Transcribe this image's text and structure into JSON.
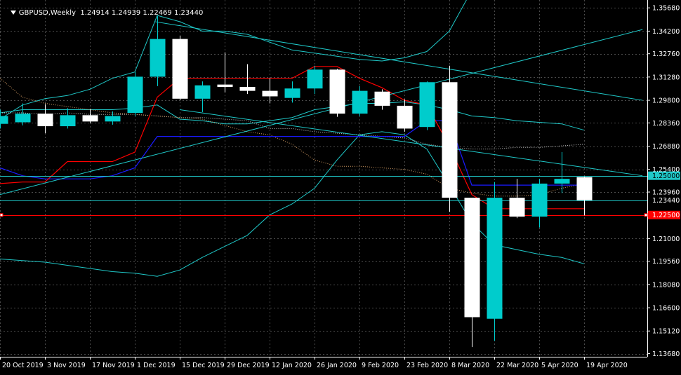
{
  "header": {
    "symbol": "GBPUSD,Weekly",
    "ohlc": "1.24914 1.24939 1.22469 1.23440"
  },
  "colors": {
    "background": "#000000",
    "grid": "#4a4a4a",
    "bull": "#00cccc",
    "bear": "#ffffff",
    "ma_red": "#ff0000",
    "ma_blue": "#1a1aff",
    "cyan_lines": "#1fc8c8",
    "hline_red": "#ff0000",
    "axis_text": "#ffffff"
  },
  "chart_data": {
    "type": "candlestick",
    "ylim": [
      1.1348,
      1.3618
    ],
    "y_ticks": [
      "1.35680",
      "1.34200",
      "1.32760",
      "1.31280",
      "1.29800",
      "1.28360",
      "1.26880",
      "1.25400",
      "1.23960",
      "1.22500",
      "1.21000",
      "1.19560",
      "1.18080",
      "1.16600",
      "1.15120",
      "1.13680"
    ],
    "x_labels": [
      {
        "i": 0,
        "label": "20 Oct 2019"
      },
      {
        "i": 2,
        "label": "3 Nov 2019"
      },
      {
        "i": 4,
        "label": "17 Nov 2019"
      },
      {
        "i": 6,
        "label": "1 Dec 2019"
      },
      {
        "i": 8,
        "label": "15 Dec 2019"
      },
      {
        "i": 10,
        "label": "29 Dec 2019"
      },
      {
        "i": 12,
        "label": "12 Jan 2020"
      },
      {
        "i": 14,
        "label": "26 Jan 2020"
      },
      {
        "i": 16,
        "label": "9 Feb 2020"
      },
      {
        "i": 18,
        "label": "23 Feb 2020"
      },
      {
        "i": 20,
        "label": "8 Mar 2020"
      },
      {
        "i": 22,
        "label": "22 Mar 2020"
      },
      {
        "i": 24,
        "label": "5 Apr 2020"
      },
      {
        "i": 26,
        "label": "19 Apr 2020"
      }
    ],
    "candles": [
      {
        "o": 1.283,
        "h": 1.292,
        "l": 1.28,
        "c": 1.288
      },
      {
        "o": 1.284,
        "h": 1.296,
        "l": 1.282,
        "c": 1.2895
      },
      {
        "o": 1.2895,
        "h": 1.2955,
        "l": 1.277,
        "c": 1.2815
      },
      {
        "o": 1.2815,
        "h": 1.293,
        "l": 1.28,
        "c": 1.2885
      },
      {
        "o": 1.2885,
        "h": 1.2925,
        "l": 1.2835,
        "c": 1.2845
      },
      {
        "o": 1.2845,
        "h": 1.291,
        "l": 1.2825,
        "c": 1.288
      },
      {
        "o": 1.29,
        "h": 1.316,
        "l": 1.288,
        "c": 1.313
      },
      {
        "o": 1.313,
        "h": 1.3515,
        "l": 1.307,
        "c": 1.337
      },
      {
        "o": 1.337,
        "h": 1.339,
        "l": 1.298,
        "c": 1.299
      },
      {
        "o": 1.299,
        "h": 1.31,
        "l": 1.2905,
        "c": 1.3075
      },
      {
        "o": 1.308,
        "h": 1.3285,
        "l": 1.303,
        "c": 1.3065
      },
      {
        "o": 1.3065,
        "h": 1.321,
        "l": 1.302,
        "c": 1.304
      },
      {
        "o": 1.304,
        "h": 1.312,
        "l": 1.296,
        "c": 1.3005
      },
      {
        "o": 1.2995,
        "h": 1.31,
        "l": 1.2965,
        "c": 1.3055
      },
      {
        "o": 1.3055,
        "h": 1.32,
        "l": 1.302,
        "c": 1.3175
      },
      {
        "o": 1.3175,
        "h": 1.318,
        "l": 1.2875,
        "c": 1.2895
      },
      {
        "o": 1.2895,
        "h": 1.307,
        "l": 1.288,
        "c": 1.304
      },
      {
        "o": 1.3035,
        "h": 1.305,
        "l": 1.292,
        "c": 1.2945
      },
      {
        "o": 1.2945,
        "h": 1.2985,
        "l": 1.278,
        "c": 1.28
      },
      {
        "o": 1.281,
        "h": 1.31,
        "l": 1.279,
        "c": 1.3095
      },
      {
        "o": 1.3095,
        "h": 1.32,
        "l": 1.227,
        "c": 1.236
      },
      {
        "o": 1.236,
        "h": 1.236,
        "l": 1.141,
        "c": 1.16
      },
      {
        "o": 1.159,
        "h": 1.246,
        "l": 1.145,
        "c": 1.236
      },
      {
        "o": 1.236,
        "h": 1.248,
        "l": 1.223,
        "c": 1.224
      },
      {
        "o": 1.224,
        "h": 1.248,
        "l": 1.217,
        "c": 1.245
      },
      {
        "o": 1.245,
        "h": 1.265,
        "l": 1.239,
        "c": 1.248
      },
      {
        "o": 1.2491,
        "h": 1.2494,
        "l": 1.2247,
        "c": 1.2344
      }
    ],
    "ma_red": [
      1.245,
      1.246,
      1.246,
      1.259,
      1.259,
      1.259,
      1.265,
      1.3,
      1.312,
      1.312,
      1.312,
      1.312,
      1.312,
      1.312,
      1.3195,
      1.3195,
      1.312,
      1.306,
      1.298,
      1.295,
      1.269,
      1.238,
      1.229,
      1.229,
      1.229,
      1.229,
      1.229
    ],
    "ma_blue": [
      1.255,
      1.25,
      1.248,
      1.248,
      1.248,
      1.25,
      1.255,
      1.275,
      1.275,
      1.275,
      1.275,
      1.275,
      1.275,
      1.275,
      1.275,
      1.275,
      1.275,
      1.275,
      1.275,
      1.285,
      1.285,
      1.244,
      1.244,
      1.244,
      1.244,
      1.244,
      1.244
    ],
    "orange_dotted": [
      1.312,
      1.3,
      1.296,
      1.294,
      1.292,
      1.29,
      1.289,
      1.288,
      1.287,
      1.286,
      1.282,
      1.278,
      1.276,
      1.27,
      1.26,
      1.256,
      1.256,
      1.255,
      1.254,
      1.251,
      1.242,
      1.239,
      1.237,
      1.237,
      1.238,
      1.242,
      1.245
    ],
    "white_dotted": [
      1.29,
      1.29,
      1.289,
      1.29,
      1.289,
      1.289,
      1.289,
      1.288,
      1.287,
      1.287,
      1.286,
      1.285,
      1.28,
      1.28,
      1.278,
      1.277,
      1.276,
      1.275,
      1.274,
      1.27,
      1.268,
      1.267,
      1.267,
      1.268,
      1.268,
      1.269,
      1.27
    ],
    "bb_upper": [
      1.286,
      1.295,
      1.299,
      1.301,
      1.305,
      1.312,
      1.316,
      1.352,
      1.348,
      1.342,
      1.342,
      1.34,
      1.335,
      1.33,
      1.328,
      1.326,
      1.324,
      1.323,
      1.325,
      1.329,
      1.342,
      1.368,
      1.37,
      1.37,
      1.37,
      1.365,
      1.362
    ],
    "bb_middle": [
      1.29,
      1.292,
      1.292,
      1.292,
      1.292,
      1.292,
      1.293,
      1.295,
      1.286,
      1.285,
      1.283,
      1.283,
      1.285,
      1.287,
      1.292,
      1.294,
      1.296,
      1.296,
      1.297,
      1.295,
      1.292,
      1.288,
      1.287,
      1.285,
      1.284,
      1.283,
      1.279
    ],
    "bb_lower": [
      1.197,
      1.196,
      1.195,
      1.193,
      1.191,
      1.189,
      1.188,
      1.186,
      1.19,
      1.198,
      1.205,
      1.212,
      1.225,
      1.232,
      1.242,
      1.26,
      1.276,
      1.278,
      1.276,
      1.267,
      1.244,
      1.22,
      1.206,
      1.203,
      1.2,
      1.198,
      1.194
    ],
    "trend_lines": [
      {
        "x1": 0,
        "y1": 1.238,
        "x2": 28.6,
        "y2": 1.343
      },
      {
        "x1": 6.9,
        "y1": 1.348,
        "x2": 28.6,
        "y2": 1.298
      },
      {
        "x1": 8.0,
        "y1": 1.292,
        "x2": 28.6,
        "y2": 1.25
      }
    ],
    "h_lines": [
      {
        "price": 1.25,
        "label": "1.25000",
        "color": "#1fc8c8",
        "label_bg": "#1fc8c8",
        "label_fg": "#000000"
      },
      {
        "price": 1.2344,
        "label": "1.23440",
        "color": "#1fc8c8",
        "label_bg": "#000000",
        "label_fg": "#ffffff"
      },
      {
        "price": 1.225,
        "label": "1.22500",
        "color": "#ff0000",
        "label_bg": "#ff0000",
        "label_fg": "#ffffff"
      }
    ]
  }
}
